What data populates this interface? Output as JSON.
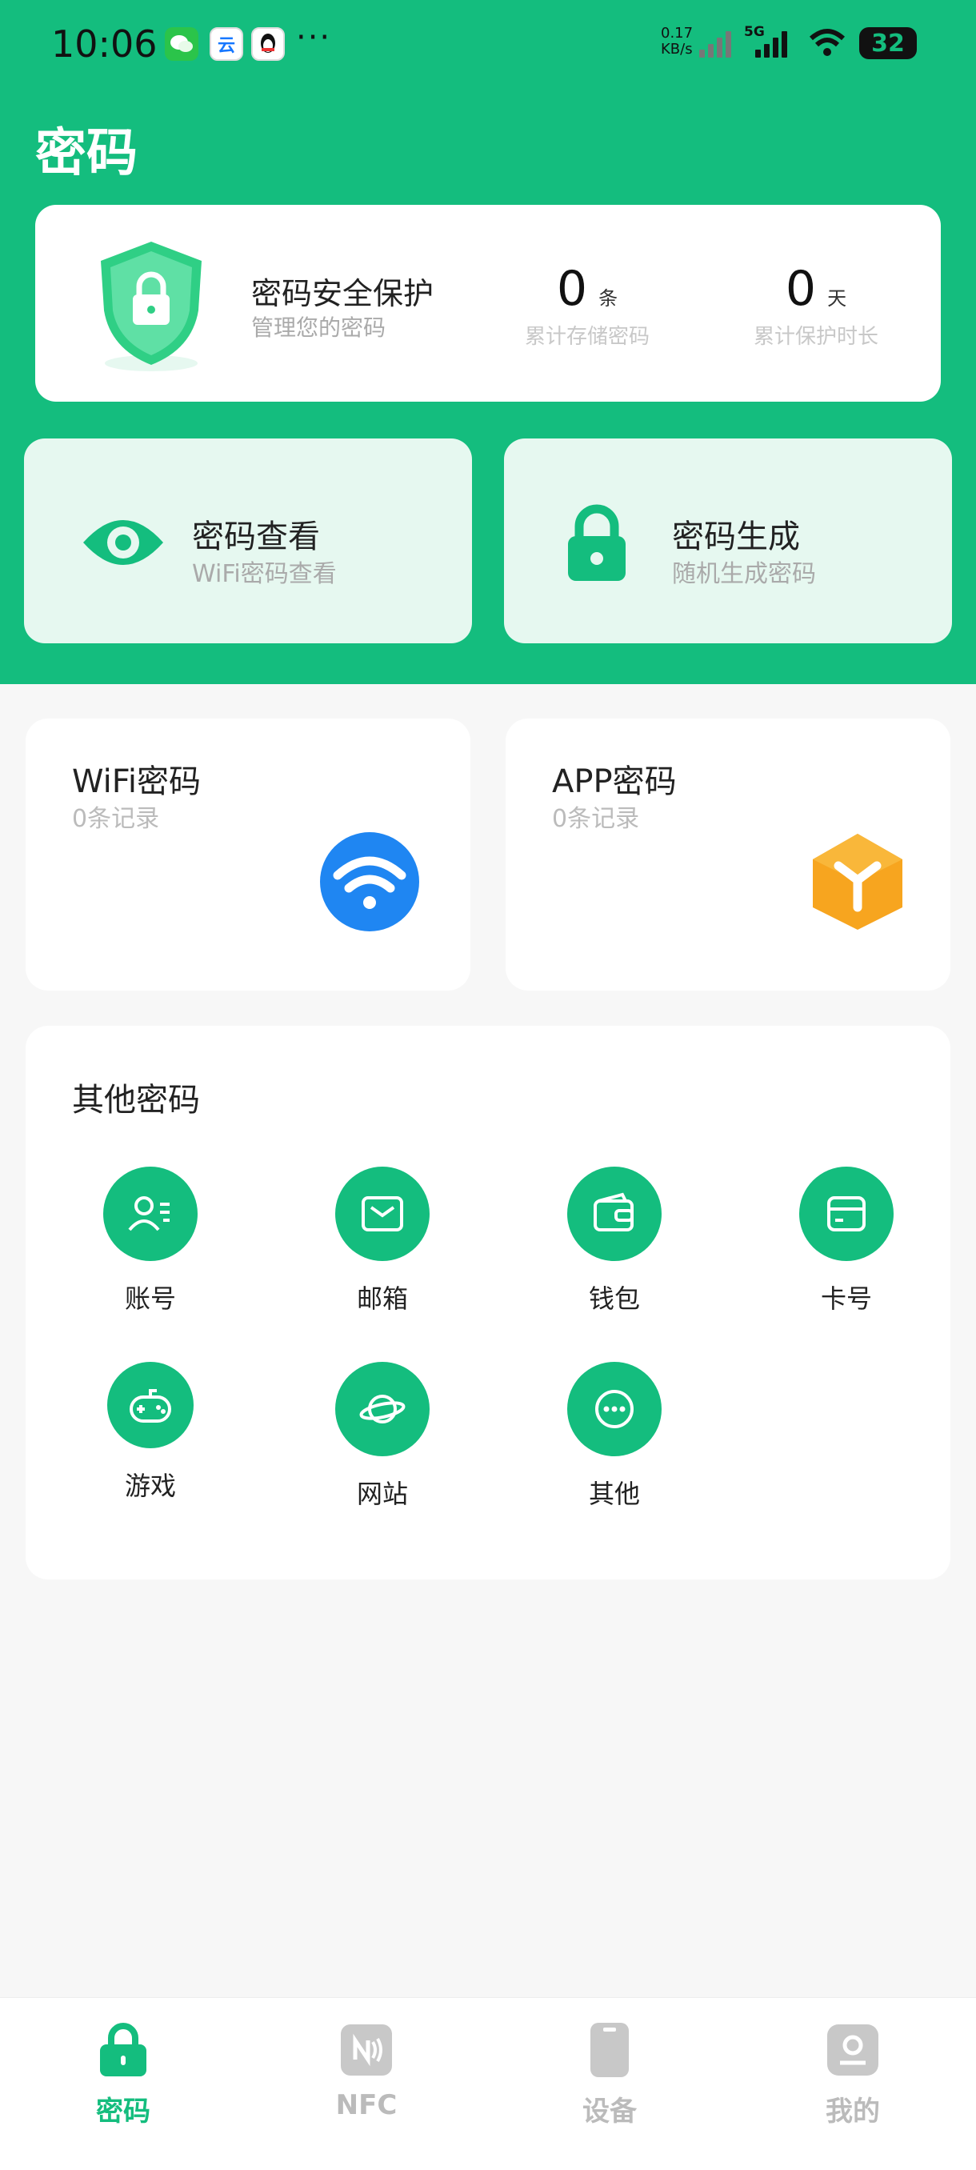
{
  "status_bar": {
    "time": "10:06",
    "more": "···",
    "net_speed_value": "0.17",
    "net_speed_unit": "KB/s",
    "network": "5G",
    "battery": "32"
  },
  "page_title": "密码",
  "summary": {
    "title": "密码安全保护",
    "subtitle": "管理您的密码",
    "stats": [
      {
        "value": "0",
        "unit": "条",
        "label": "累计存储密码"
      },
      {
        "value": "0",
        "unit": "天",
        "label": "累计保护时长"
      }
    ]
  },
  "features": [
    {
      "title": "密码查看",
      "subtitle": "WiFi密码查看",
      "icon": "eye-icon"
    },
    {
      "title": "密码生成",
      "subtitle": "随机生成密码",
      "icon": "lock-icon"
    }
  ],
  "records": [
    {
      "title": "WiFi密码",
      "count": "0条记录",
      "icon": "wifi-icon"
    },
    {
      "title": "APP密码",
      "count": "0条记录",
      "icon": "app-cube-icon"
    }
  ],
  "other": {
    "title": "其他密码",
    "items": [
      {
        "label": "账号",
        "icon": "account-icon"
      },
      {
        "label": "邮箱",
        "icon": "mail-icon"
      },
      {
        "label": "钱包",
        "icon": "wallet-icon"
      },
      {
        "label": "卡号",
        "icon": "card-icon"
      },
      {
        "label": "游戏",
        "icon": "gamepad-icon"
      },
      {
        "label": "网站",
        "icon": "planet-icon"
      },
      {
        "label": "其他",
        "icon": "more-icon"
      }
    ]
  },
  "nav": [
    {
      "label": "密码",
      "icon": "lock-icon",
      "active": true
    },
    {
      "label": "NFC",
      "icon": "nfc-icon",
      "active": false
    },
    {
      "label": "设备",
      "icon": "phone-icon",
      "active": false
    },
    {
      "label": "我的",
      "icon": "user-icon",
      "active": false
    }
  ],
  "colors": {
    "accent": "#14bd7e",
    "light_accent": "#e6f8f0",
    "background": "#f7f7f7"
  }
}
